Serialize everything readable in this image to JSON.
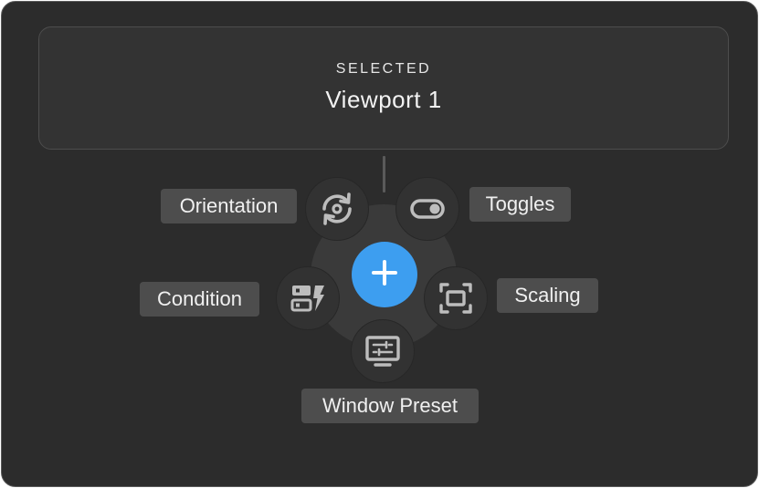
{
  "header": {
    "caption": "SELECTED",
    "title": "Viewport 1"
  },
  "radial_menu": {
    "center_button": {
      "icon": "plus-icon"
    },
    "items": [
      {
        "id": "orientation",
        "label": "Orientation",
        "icon": "rotate-icon"
      },
      {
        "id": "toggles",
        "label": "Toggles",
        "icon": "toggle-switch-icon"
      },
      {
        "id": "condition",
        "label": "Condition",
        "icon": "condition-bolt-icon"
      },
      {
        "id": "scaling",
        "label": "Scaling",
        "icon": "scale-frame-icon"
      },
      {
        "id": "window_preset",
        "label": "Window Preset",
        "icon": "monitor-settings-icon"
      }
    ]
  },
  "colors": {
    "background": "#2c2c2c",
    "card": "#333333",
    "accent": "#3d9ef0",
    "pill": "#4d4d4d",
    "icon": "#bdbdbd"
  }
}
